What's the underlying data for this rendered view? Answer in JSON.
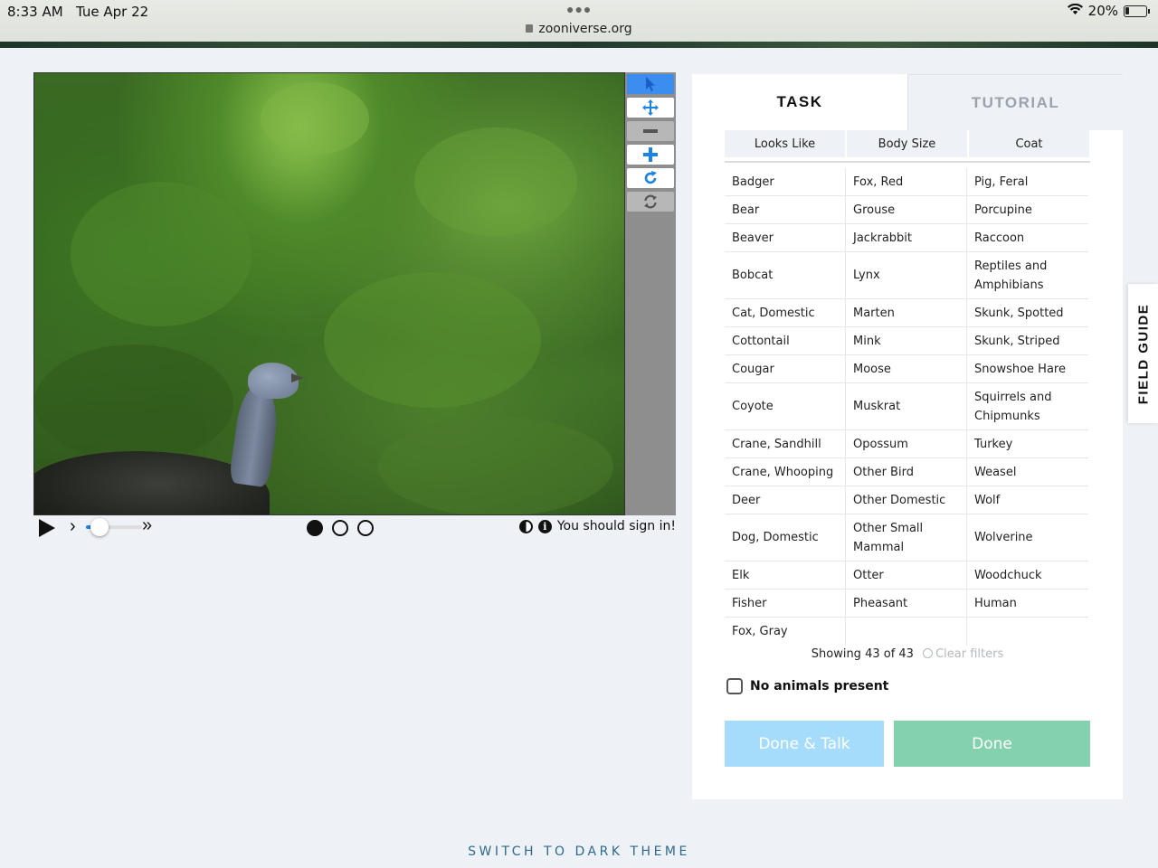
{
  "status": {
    "time": "8:33 AM",
    "date": "Tue Apr 22",
    "url": "zooniverse.org",
    "wifi": "wifi-icon",
    "battery": "20%"
  },
  "viewer": {
    "tools": [
      {
        "name": "pointer-icon",
        "state": "active"
      },
      {
        "name": "move-icon",
        "state": "enabled"
      },
      {
        "name": "zoom-out-icon",
        "state": "disabled"
      },
      {
        "name": "zoom-in-icon",
        "state": "enabled"
      },
      {
        "name": "rotate-icon",
        "state": "enabled"
      },
      {
        "name": "reset-icon",
        "state": "disabled"
      }
    ],
    "frames": 3,
    "current_frame": 1,
    "sign_in_text": "You should sign in!"
  },
  "tabs": {
    "task": "TASK",
    "tutorial": "TUTORIAL"
  },
  "filters": [
    "Looks Like",
    "Body Size",
    "Coat"
  ],
  "choices": {
    "col1": [
      "Badger",
      "Bear",
      "Beaver",
      "Bobcat",
      "Cat, Domestic",
      "Cottontail",
      "Cougar",
      "Coyote",
      "Crane, Sandhill",
      "Crane, Whooping",
      "Deer",
      "Dog, Domestic",
      "Elk",
      "Fisher",
      "Fox, Gray"
    ],
    "col2": [
      "Fox, Red",
      "Grouse",
      "Jackrabbit",
      "Lynx",
      "Marten",
      "Mink",
      "Moose",
      "Muskrat",
      "Opossum",
      "Other Bird",
      "Other Domestic",
      "Other Small Mammal",
      "Otter",
      "Pheasant"
    ],
    "col3": [
      "Pig, Feral",
      "Porcupine",
      "Raccoon",
      "Reptiles and Amphibians",
      "Skunk, Spotted",
      "Skunk, Striped",
      "Snowshoe Hare",
      "Squirrels and Chipmunks",
      "Turkey",
      "Weasel",
      "Wolf",
      "Wolverine",
      "Woodchuck",
      "Human"
    ]
  },
  "showing": "Showing 43 of 43",
  "clear_filters": "Clear filters",
  "no_animals": "No animals present",
  "buttons": {
    "done_talk": "Done & Talk",
    "done": "Done"
  },
  "field_guide": "FIELD GUIDE",
  "dark_theme": "SWITCH TO DARK THEME"
}
